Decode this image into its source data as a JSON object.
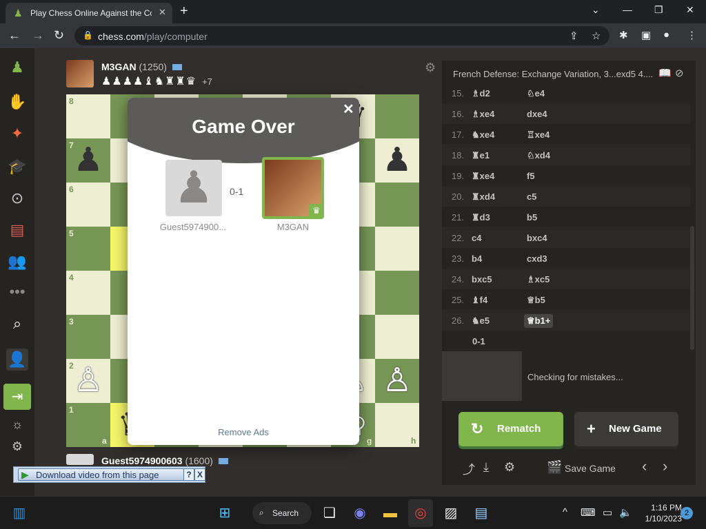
{
  "browser": {
    "tab_title": "Play Chess Online Against the Co",
    "url_host": "chess.com",
    "url_path": "/play/computer"
  },
  "top_player": {
    "name": "M3GAN",
    "rating": "(1250)",
    "captures": "♟♟♟♟♝♞♜♜♛",
    "advantage": "+7"
  },
  "bottom_player": {
    "name": "Guest5974900603",
    "rating": "(1600)"
  },
  "board": {
    "ranks": [
      "8",
      "7",
      "6",
      "5",
      "4",
      "3",
      "2",
      "1"
    ],
    "files": [
      "a",
      "g",
      "h"
    ]
  },
  "modal": {
    "title": "Game Over",
    "score": "0-1",
    "loser_name": "Guest5974900...",
    "winner_name": "M3GAN",
    "remove_ads": "Remove Ads"
  },
  "panel": {
    "opening": "French Defense: Exchange Variation, 3...exd5 4....",
    "moves": [
      {
        "n": "15.",
        "w": "♗d2",
        "b": "♘e4"
      },
      {
        "n": "16.",
        "w": "♗xe4",
        "b": "dxe4"
      },
      {
        "n": "17.",
        "w": "♞xe4",
        "b": "♖xe4"
      },
      {
        "n": "18.",
        "w": "♜e1",
        "b": "♘xd4"
      },
      {
        "n": "19.",
        "w": "♜xe4",
        "b": "f5"
      },
      {
        "n": "20.",
        "w": "♜xd4",
        "b": "c5"
      },
      {
        "n": "21.",
        "w": "♜d3",
        "b": "b5"
      },
      {
        "n": "22.",
        "w": "c4",
        "b": "bxc4"
      },
      {
        "n": "23.",
        "w": "b4",
        "b": "cxd3"
      },
      {
        "n": "24.",
        "w": "bxc5",
        "b": "♗xc5"
      },
      {
        "n": "25.",
        "w": "♝f4",
        "b": "♕b5"
      },
      {
        "n": "26.",
        "w": "♞e5",
        "b": "♕b1+"
      }
    ],
    "result": "0-1",
    "coach_message": "Checking for mistakes...",
    "rematch_label": "Rematch",
    "new_game_label": "New Game",
    "save_game_label": "Save Game"
  },
  "download_bar": {
    "label": "Download video from this page",
    "help": "?",
    "close": "X"
  },
  "taskbar": {
    "search_label": "Search",
    "time": "1:16 PM",
    "date": "1/10/2023",
    "notifications": "2"
  },
  "colors": {
    "board_light": "#eeeed2",
    "board_dark": "#769656",
    "accent_green": "#81b64c",
    "panel_bg": "#262421",
    "page_bg": "#312e2b"
  }
}
